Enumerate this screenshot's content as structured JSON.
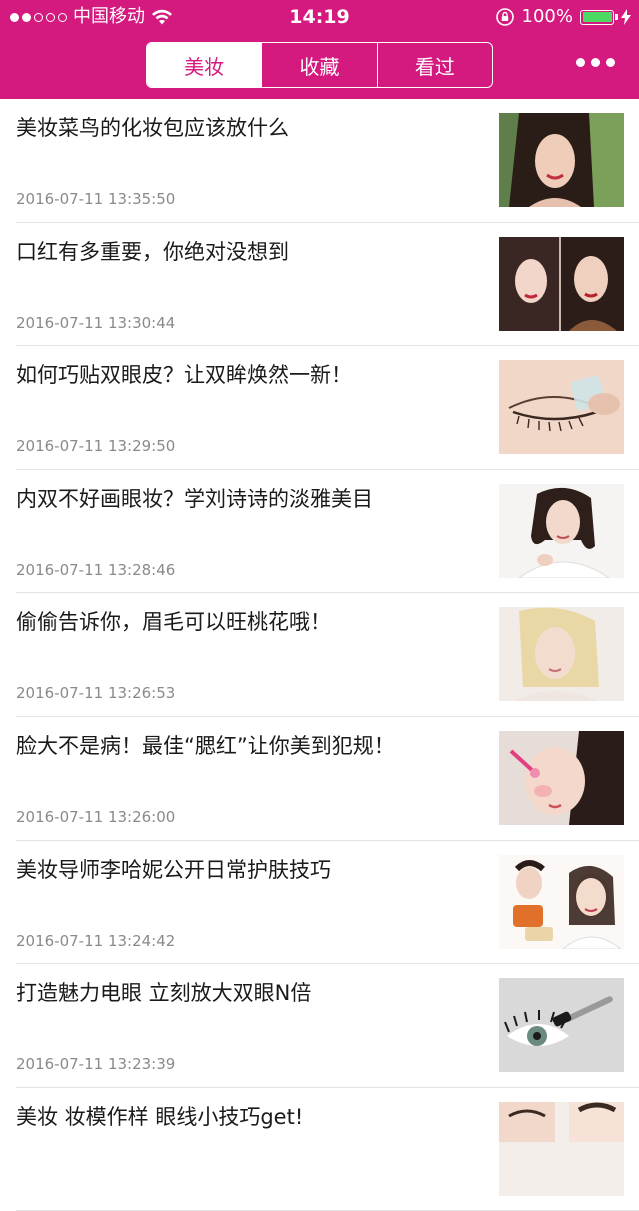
{
  "status": {
    "carrier": "中国移动",
    "time": "14:19",
    "battery": "100%",
    "battery_level": 1.0,
    "signal_dots_filled": 2,
    "signal_dots_total": 5
  },
  "tabs": [
    {
      "label": "美妆",
      "active": true
    },
    {
      "label": "收藏",
      "active": false
    },
    {
      "label": "看过",
      "active": false
    }
  ],
  "colors": {
    "brand": "#d4197f",
    "title_text": "#1a1a1a",
    "date_text": "#8a8a8a",
    "battery": "#4cd964"
  },
  "articles": [
    {
      "title": "美妆菜鸟的化妆包应该放什么",
      "date": "2016-07-11 13:35:50",
      "thumb": "woman-portrait-thumbnail"
    },
    {
      "title": "口红有多重要，你绝对没想到",
      "date": "2016-07-11 13:30:44",
      "thumb": "two-women-lipstick-thumbnail"
    },
    {
      "title": "如何巧贴双眼皮？让双眸焕然一新！",
      "date": "2016-07-11 13:29:50",
      "thumb": "eyelid-tape-thumbnail"
    },
    {
      "title": "内双不好画眼妆？学刘诗诗的淡雅美目",
      "date": "2016-07-11 13:28:46",
      "thumb": "actress-portrait-thumbnail"
    },
    {
      "title": "偷偷告诉你，眉毛可以旺桃花哦！",
      "date": "2016-07-11 13:26:53",
      "thumb": "blonde-woman-thumbnail"
    },
    {
      "title": "脸大不是病！最佳“腮红”让你美到犯规！",
      "date": "2016-07-11 13:26:00",
      "thumb": "blush-makeup-thumbnail"
    },
    {
      "title": "美妆导师李哈妮公开日常护肤技巧",
      "date": "2016-07-11 13:24:42",
      "thumb": "skincare-products-thumbnail"
    },
    {
      "title": "打造魅力电眼 立刻放大双眼N倍",
      "date": "2016-07-11 13:23:39",
      "thumb": "mascara-eye-thumbnail"
    },
    {
      "title": "美妆 妆模作样 眼线小技巧get!",
      "date": "",
      "thumb": "eyeliner-models-thumbnail"
    }
  ]
}
